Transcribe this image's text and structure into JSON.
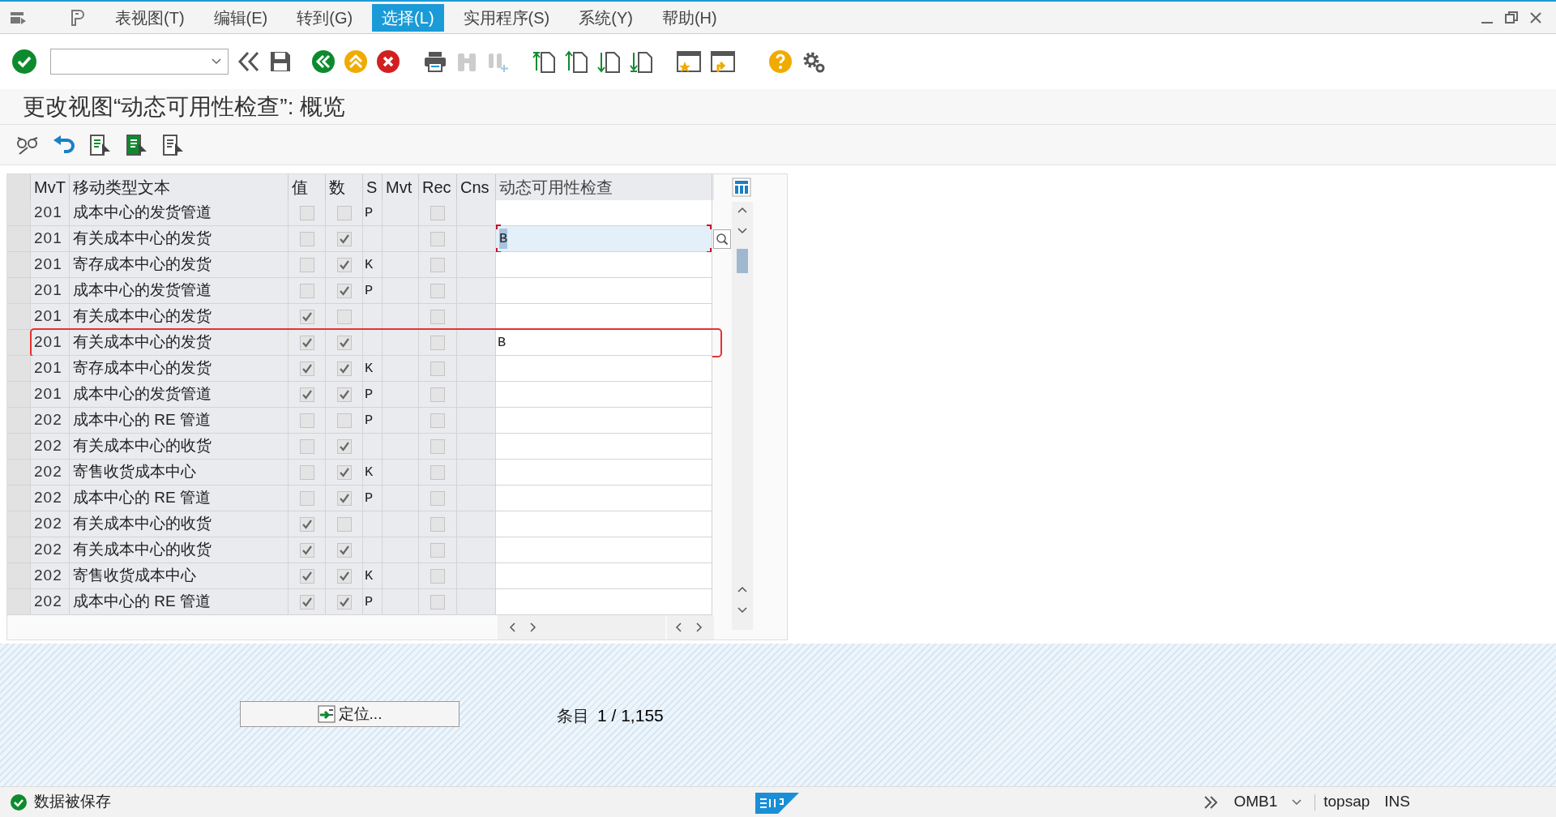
{
  "menu": [
    {
      "label": "表视图(T)",
      "selected": false
    },
    {
      "label": "编辑(E)",
      "selected": false
    },
    {
      "label": "转到(G)",
      "selected": false
    },
    {
      "label": "选择(L)",
      "selected": true
    },
    {
      "label": "实用程序(S)",
      "selected": false
    },
    {
      "label": "系统(Y)",
      "selected": false
    },
    {
      "label": "帮助(H)",
      "selected": false
    }
  ],
  "title": "更改视图“动态可用性检查”: 概览",
  "table": {
    "columns": [
      "MvT",
      "移动类型文本",
      "值",
      "数",
      "S",
      "Mvt",
      "Rec",
      "Cns",
      "动态可用性检查"
    ],
    "rows": [
      {
        "mvt": "201",
        "text": "成本中心的发货管道",
        "val": false,
        "num": false,
        "s": "P",
        "rec": false,
        "check": "",
        "focused": false,
        "highlighted": false
      },
      {
        "mvt": "201",
        "text": "有关成本中心的发货",
        "val": false,
        "num": true,
        "s": "",
        "rec": false,
        "check": "B",
        "focused": true,
        "highlighted": false
      },
      {
        "mvt": "201",
        "text": "寄存成本中心的发货",
        "val": false,
        "num": true,
        "s": "K",
        "rec": false,
        "check": "",
        "focused": false,
        "highlighted": false
      },
      {
        "mvt": "201",
        "text": "成本中心的发货管道",
        "val": false,
        "num": true,
        "s": "P",
        "rec": false,
        "check": "",
        "focused": false,
        "highlighted": false
      },
      {
        "mvt": "201",
        "text": "有关成本中心的发货",
        "val": true,
        "num": false,
        "s": "",
        "rec": false,
        "check": "",
        "focused": false,
        "highlighted": false
      },
      {
        "mvt": "201",
        "text": "有关成本中心的发货",
        "val": true,
        "num": true,
        "s": "",
        "rec": false,
        "check": "B",
        "focused": false,
        "highlighted": true
      },
      {
        "mvt": "201",
        "text": "寄存成本中心的发货",
        "val": true,
        "num": true,
        "s": "K",
        "rec": false,
        "check": "",
        "focused": false,
        "highlighted": false
      },
      {
        "mvt": "201",
        "text": "成本中心的发货管道",
        "val": true,
        "num": true,
        "s": "P",
        "rec": false,
        "check": "",
        "focused": false,
        "highlighted": false
      },
      {
        "mvt": "202",
        "text": "成本中心的 RE 管道",
        "val": false,
        "num": false,
        "s": "P",
        "rec": false,
        "check": "",
        "focused": false,
        "highlighted": false
      },
      {
        "mvt": "202",
        "text": "有关成本中心的收货",
        "val": false,
        "num": true,
        "s": "",
        "rec": false,
        "check": "",
        "focused": false,
        "highlighted": false
      },
      {
        "mvt": "202",
        "text": "寄售收货成本中心",
        "val": false,
        "num": true,
        "s": "K",
        "rec": false,
        "check": "",
        "focused": false,
        "highlighted": false
      },
      {
        "mvt": "202",
        "text": "成本中心的 RE 管道",
        "val": false,
        "num": true,
        "s": "P",
        "rec": false,
        "check": "",
        "focused": false,
        "highlighted": false
      },
      {
        "mvt": "202",
        "text": "有关成本中心的收货",
        "val": true,
        "num": false,
        "s": "",
        "rec": false,
        "check": "",
        "focused": false,
        "highlighted": false
      },
      {
        "mvt": "202",
        "text": "有关成本中心的收货",
        "val": true,
        "num": true,
        "s": "",
        "rec": false,
        "check": "",
        "focused": false,
        "highlighted": false
      },
      {
        "mvt": "202",
        "text": "寄售收货成本中心",
        "val": true,
        "num": true,
        "s": "K",
        "rec": false,
        "check": "",
        "focused": false,
        "highlighted": false
      },
      {
        "mvt": "202",
        "text": "成本中心的 RE 管道",
        "val": true,
        "num": true,
        "s": "P",
        "rec": false,
        "check": "",
        "focused": false,
        "highlighted": false
      }
    ]
  },
  "position_button": "定位...",
  "entry_label": "条目",
  "entry_count": "1 / 1,155",
  "status": {
    "message": "数据被保存",
    "transaction": "OMB1",
    "server": "topsap",
    "mode": "INS"
  }
}
